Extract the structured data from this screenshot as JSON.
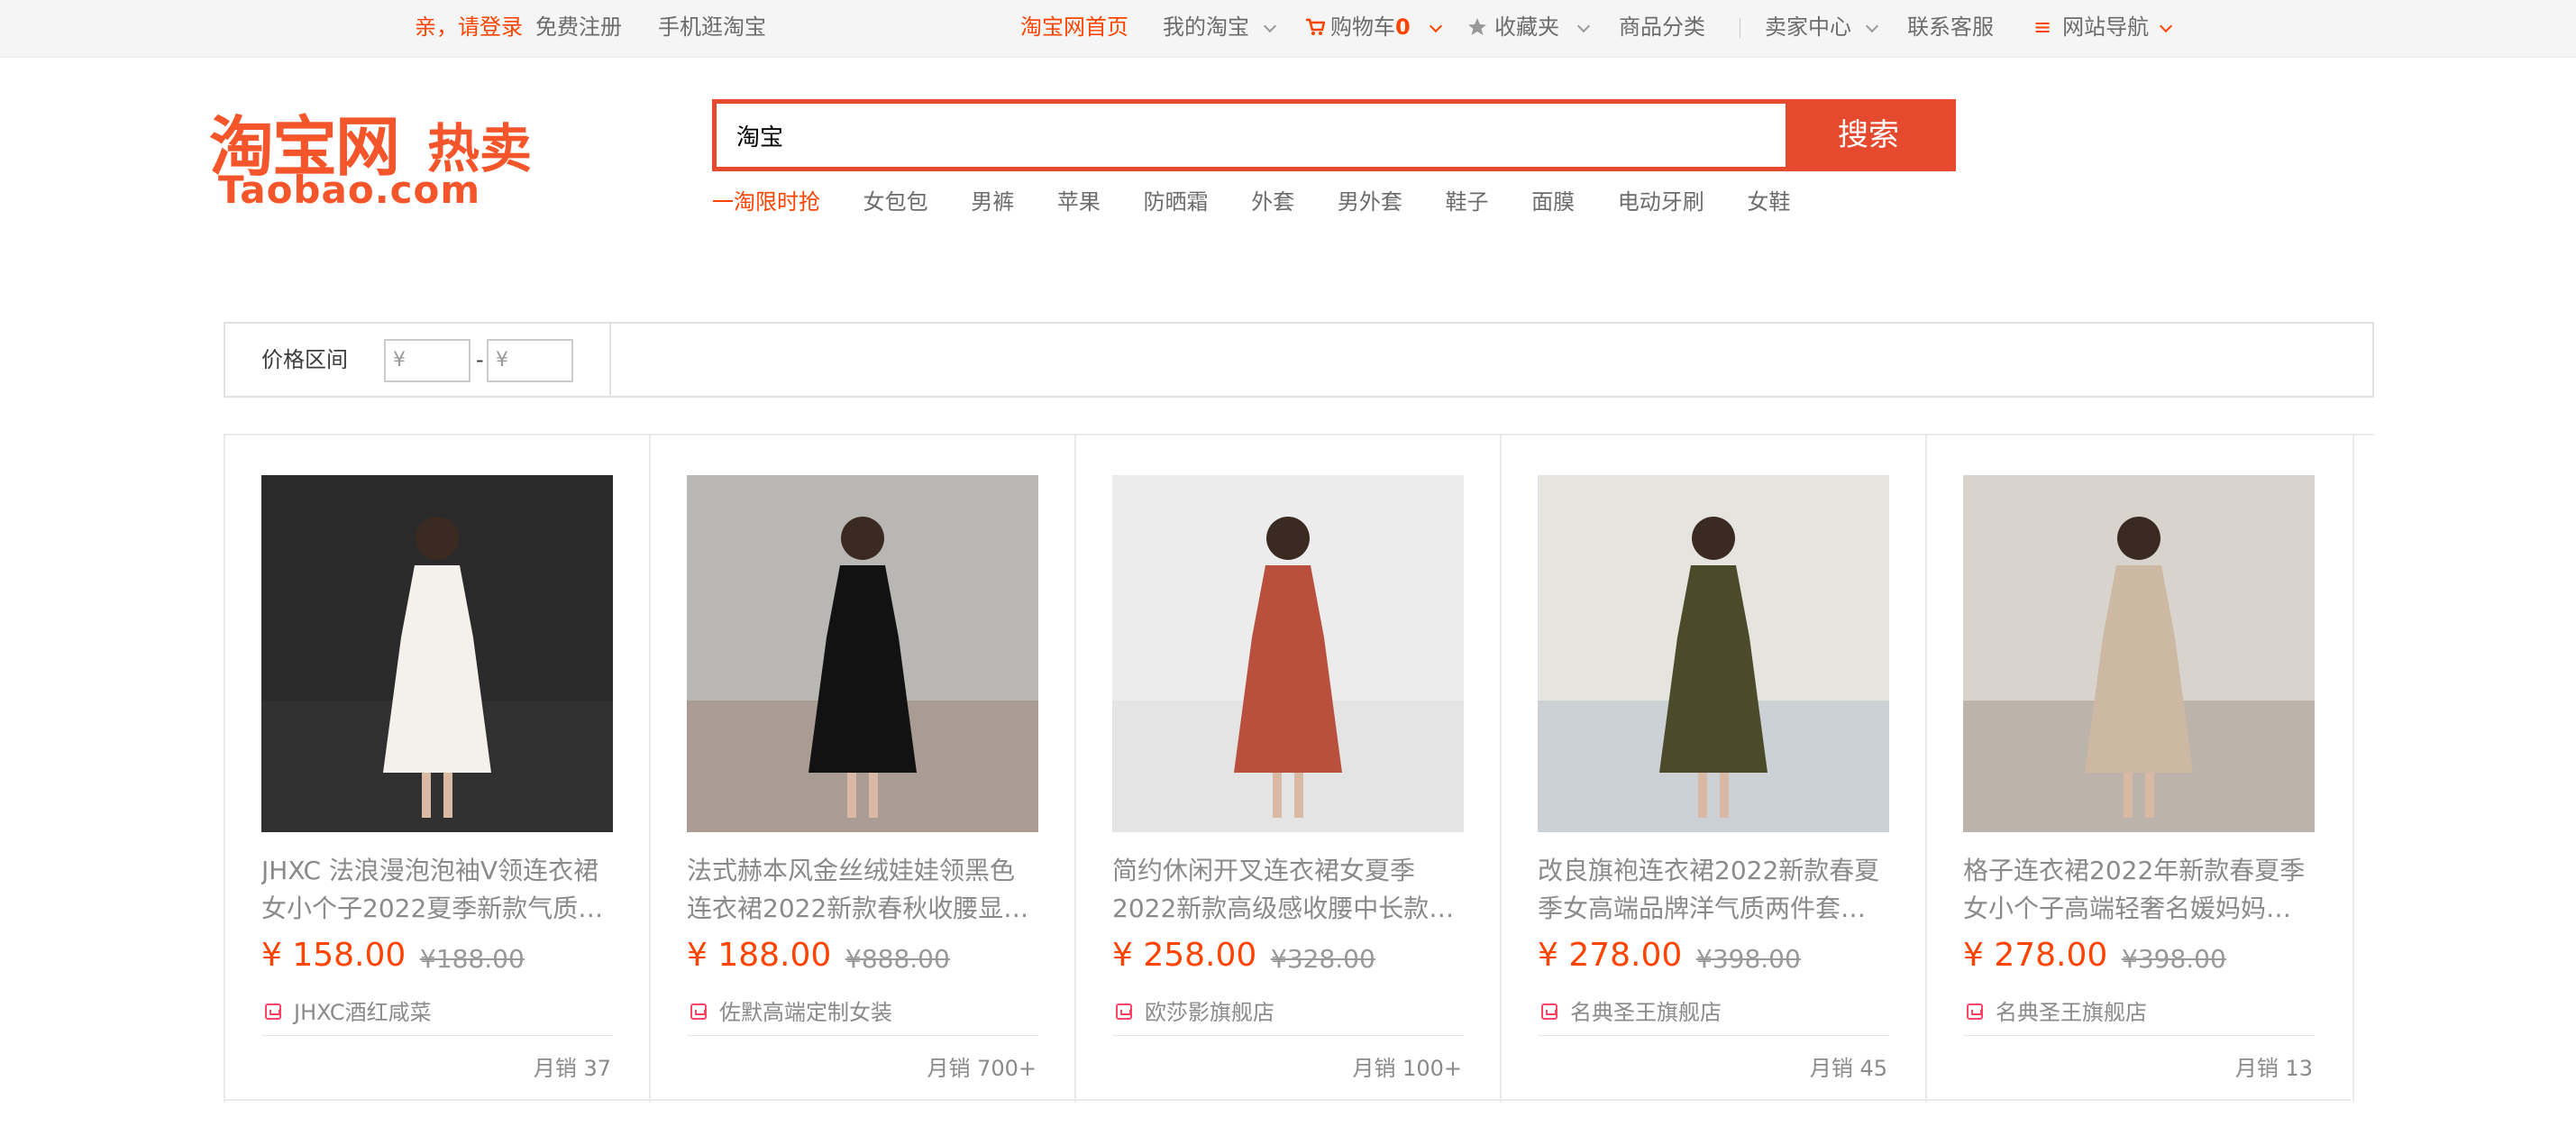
{
  "topbar": {
    "login": "亲，请登录",
    "register": "免费注册",
    "mobile": "手机逛淘宝",
    "home": "淘宝网首页",
    "my_taobao": "我的淘宝",
    "cart_label": "购物车",
    "cart_count": "0",
    "favorites": "收藏夹",
    "categories": "商品分类",
    "seller_center": "卖家中心",
    "customer_service": "联系客服",
    "site_nav": "网站导航"
  },
  "logo": {
    "main": "淘宝网",
    "sub": "热卖",
    "domain": "Taobao.com"
  },
  "search": {
    "value": "淘宝",
    "button": "搜索",
    "hot_words": [
      "一淘限时抢",
      "女包包",
      "男裤",
      "苹果",
      "防晒霜",
      "外套",
      "男外套",
      "鞋子",
      "面膜",
      "电动牙刷",
      "女鞋"
    ]
  },
  "filter": {
    "label": "价格区间",
    "min_placeholder": "¥",
    "max_placeholder": "¥",
    "dash": "-"
  },
  "products": [
    {
      "title": "JHXC 法浪漫泡泡袖V领连衣裙女小个子2022夏季新款气质…",
      "price": "¥ 158.00",
      "old_price": "¥188.00",
      "shop": "JHXC酒红咸菜",
      "sales": "月销 37",
      "bg": "#2a2a2a",
      "dress": "#f4f1ec",
      "accent": "#3b3b3b"
    },
    {
      "title": "法式赫本风金丝绒娃娃领黑色连衣裙2022新款春秋收腰显…",
      "price": "¥ 188.00",
      "old_price": "¥888.00",
      "shop": "佐默高端定制女装",
      "sales": "月销 700+",
      "bg": "#b9b7b3",
      "dress": "#121212",
      "accent": "#8e6a55"
    },
    {
      "title": "简约休闲开叉连衣裙女夏季2022新款高级感收腰中长款…",
      "price": "¥ 258.00",
      "old_price": "¥328.00",
      "shop": "欧莎影旗舰店",
      "sales": "月销 100+",
      "bg": "#ececec",
      "dress": "#b8503d",
      "accent": "#d6d6d6"
    },
    {
      "title": "改良旗袍连衣裙2022新款春夏季女高端品牌洋气质两件套…",
      "price": "¥ 278.00",
      "old_price": "¥398.00",
      "shop": "名典圣王旗舰店",
      "sales": "月销 45",
      "bg": "#e6e4df",
      "dress": "#4b4a2a",
      "accent": "#9ab0c4"
    },
    {
      "title": "格子连衣裙2022年新款春夏季女小个子高端轻奢名媛妈妈…",
      "price": "¥ 278.00",
      "old_price": "¥398.00",
      "shop": "名典圣王旗舰店",
      "sales": "月销 13",
      "bg": "#d8d3cc",
      "dress": "#cdb8a4",
      "accent": "#8a7a6a"
    }
  ]
}
